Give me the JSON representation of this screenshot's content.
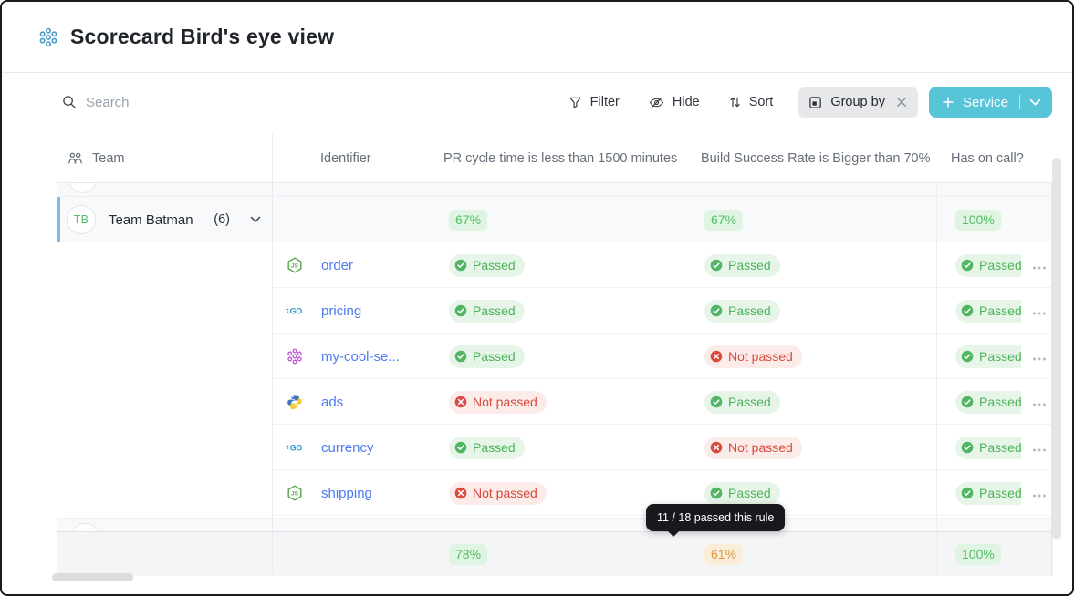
{
  "header": {
    "title": "Scorecard Bird's eye view"
  },
  "toolbar": {
    "search_placeholder": "Search",
    "filter": "Filter",
    "hide": "Hide",
    "sort": "Sort",
    "group_by": "Group by",
    "add_button": {
      "label": "Service"
    }
  },
  "table": {
    "columns": [
      {
        "key": "team",
        "label": "Team"
      },
      {
        "key": "identifier",
        "label": "Identifier"
      },
      {
        "key": "rule1",
        "label": "PR cycle time is less than 1500 minutes"
      },
      {
        "key": "rule2",
        "label": "Build Success Rate is Bigger than 70%"
      },
      {
        "key": "rule3",
        "label": "Has on call?"
      }
    ],
    "group": {
      "initials": "TB",
      "name": "Team Batman",
      "count": "(6)",
      "summary": [
        {
          "value": "67%",
          "tone": "green"
        },
        {
          "value": "67%",
          "tone": "green"
        },
        {
          "value": "100%",
          "tone": "green"
        }
      ]
    },
    "status_labels": {
      "passed": "Passed",
      "not_passed": "Not passed"
    },
    "rows": [
      {
        "identifier": "order",
        "icon": "nodejs-icon",
        "statuses": [
          "passed",
          "passed",
          "passed"
        ]
      },
      {
        "identifier": "pricing",
        "icon": "go-icon",
        "statuses": [
          "passed",
          "passed",
          "passed"
        ]
      },
      {
        "identifier": "my-cool-se...",
        "icon": "cluster-icon",
        "statuses": [
          "passed",
          "not_passed",
          "passed"
        ]
      },
      {
        "identifier": "ads",
        "icon": "python-icon",
        "statuses": [
          "not_passed",
          "passed",
          "passed"
        ]
      },
      {
        "identifier": "currency",
        "icon": "go-icon",
        "statuses": [
          "passed",
          "not_passed",
          "passed"
        ]
      },
      {
        "identifier": "shipping",
        "icon": "nodejs-icon",
        "statuses": [
          "not_passed",
          "passed",
          "passed"
        ]
      }
    ],
    "next_group_summary": [
      {
        "value": "78%",
        "tone": "green"
      },
      {
        "value": "61%",
        "tone": "orange"
      },
      {
        "value": "100%",
        "tone": "green"
      }
    ]
  },
  "tooltip": {
    "text": "11 / 18 passed this rule"
  },
  "colors": {
    "accent_teal": "#57c5d7",
    "link_blue": "#4d7af0",
    "pass_green": "#4cb35a",
    "fail_red": "#d9493c",
    "warn_orange": "#db9b3f",
    "group_highlight_blue": "#84b7ea",
    "title_icon_blue": "#4e9cc8"
  }
}
